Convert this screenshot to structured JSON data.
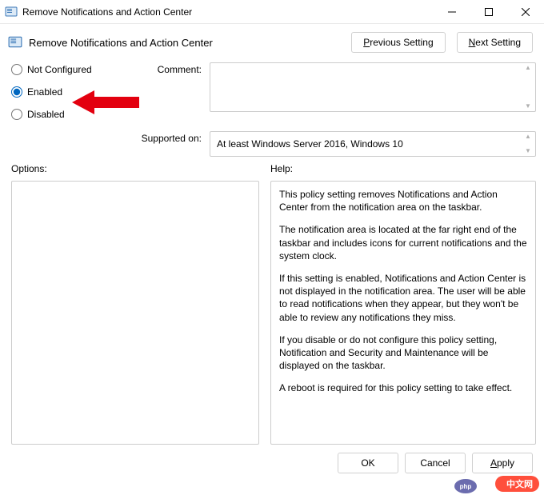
{
  "window": {
    "title": "Remove Notifications and Action Center"
  },
  "header": {
    "subtitle": "Remove Notifications and Action Center",
    "prev_label": "Previous Setting",
    "next_label": "Next Setting"
  },
  "radios": {
    "not_configured": "Not Configured",
    "enabled": "Enabled",
    "disabled": "Disabled",
    "selected": "enabled"
  },
  "labels": {
    "comment": "Comment:",
    "supported_on": "Supported on:",
    "options": "Options:",
    "help": "Help:"
  },
  "fields": {
    "comment": "",
    "supported_on": "At least Windows Server 2016, Windows 10"
  },
  "help": {
    "p1": "This policy setting removes Notifications and Action Center from the notification area on the taskbar.",
    "p2": "The notification area is located at the far right end of the taskbar and includes icons for current notifications and the system clock.",
    "p3": "If this setting is enabled, Notifications and Action Center is not displayed in the notification area. The user will be able to read notifications when they appear, but they won't be able to review any notifications they miss.",
    "p4": "If you disable or do not configure this policy setting, Notification and Security and Maintenance will be displayed on the taskbar.",
    "p5": "A reboot is required for this policy setting to take effect."
  },
  "footer": {
    "ok": "OK",
    "cancel": "Cancel",
    "apply": "Apply"
  },
  "watermark": {
    "text": "中文网",
    "sub": "php"
  }
}
